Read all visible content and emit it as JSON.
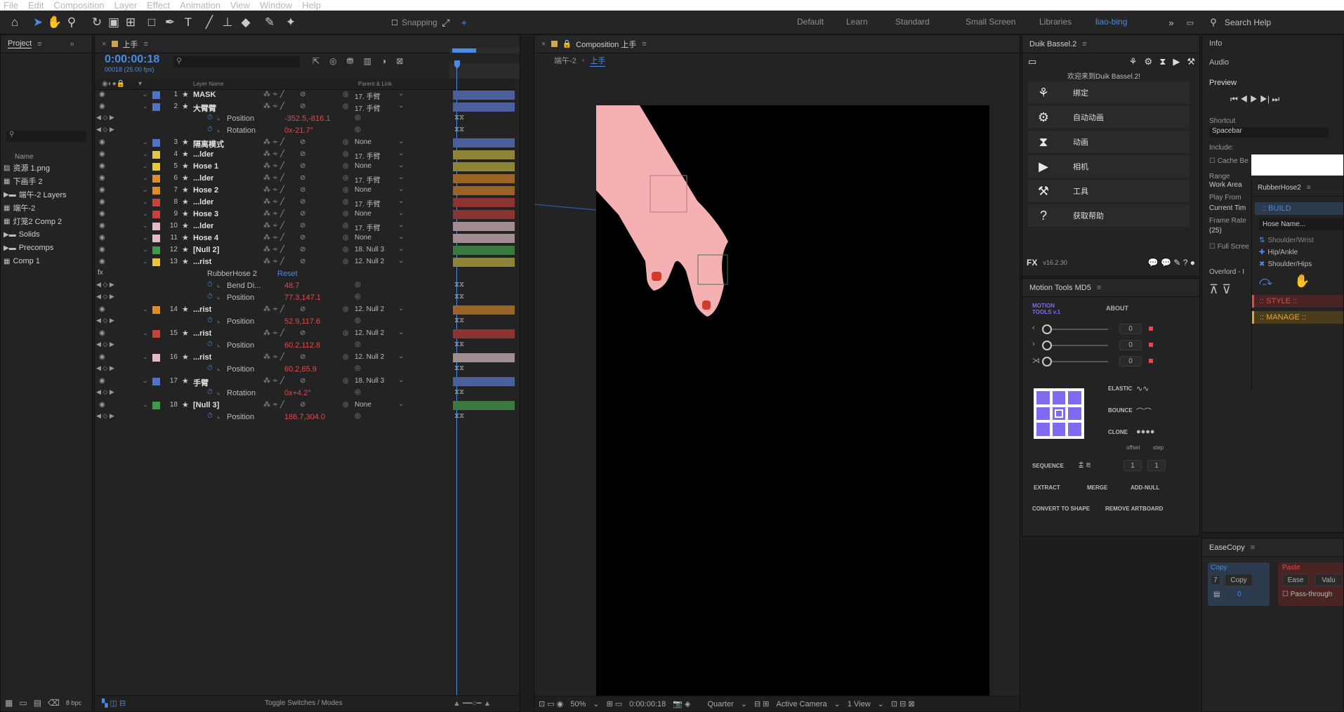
{
  "menu": [
    "File",
    "Edit",
    "Composition",
    "Layer",
    "Effect",
    "Animation",
    "View",
    "Window",
    "Help"
  ],
  "toolbar": {
    "snapping_label": "Snapping",
    "workspaces": [
      "Default",
      "Learn",
      "Standard",
      "Small Screen",
      "Libraries",
      "liao-bing"
    ],
    "active_workspace": "liao-bing",
    "search_label": "Search Help"
  },
  "project": {
    "tab": "Project",
    "search_placeholder": "",
    "name_header": "Name",
    "items": [
      {
        "label": "资源 1.png",
        "icon": "image-icon"
      },
      {
        "label": "下画手 2",
        "icon": "comp-icon"
      },
      {
        "label": "端午-2 Layers",
        "icon": "folder-icon"
      },
      {
        "label": "端午-2",
        "icon": "comp-icon"
      },
      {
        "label": "灯笼2 Comp 2",
        "icon": "comp-icon"
      },
      {
        "label": "Solids",
        "icon": "folder-icon"
      },
      {
        "label": "Precomps",
        "icon": "folder-icon"
      },
      {
        "label": "Comp 1",
        "icon": "comp-icon"
      }
    ],
    "bpc": "8 bpc"
  },
  "timeline": {
    "tab": "上手",
    "timecode": "0:00:00:18",
    "fps": "00018 (25.00 fps)",
    "col_layer_name": "Layer Name",
    "col_parent": "Parent & Link",
    "footer": "Toggle Switches / Modes",
    "rows": [
      {
        "num": "1",
        "name": "MASK",
        "parent": "17. 手臂",
        "type": "layer",
        "color": "#4e73c9",
        "bar": "#4a5f9c"
      },
      {
        "num": "2",
        "name": "大臂臂",
        "parent": "17. 手臂",
        "type": "layer",
        "color": "#4e73c9",
        "bar": "#4a5f9c"
      },
      {
        "name": "Position",
        "value": "-352.5,-816.1",
        "type": "prop"
      },
      {
        "name": "Rotation",
        "value": "0x-21.7°",
        "type": "prop"
      },
      {
        "num": "3",
        "name": "隔离模式",
        "parent": "None",
        "type": "layer",
        "color": "#4e73c9",
        "bar": "#4a5f9c"
      },
      {
        "num": "4",
        "name": "...lder",
        "parent": "17. 手臂",
        "type": "layer",
        "color": "#e8c640",
        "bar": "#8e8436"
      },
      {
        "num": "5",
        "name": "Hose 1",
        "parent": "None",
        "type": "layer",
        "color": "#e8c640",
        "bar": "#8e8436"
      },
      {
        "num": "6",
        "name": "...lder",
        "parent": "17. 手臂",
        "type": "layer",
        "color": "#e08a2a",
        "bar": "#9a6426"
      },
      {
        "num": "7",
        "name": "Hose 2",
        "parent": "None",
        "type": "layer",
        "color": "#e08a2a",
        "bar": "#9a6426"
      },
      {
        "num": "8",
        "name": "...lder",
        "parent": "17. 手臂",
        "type": "layer",
        "color": "#c9403d",
        "bar": "#8c3432"
      },
      {
        "num": "9",
        "name": "Hose 3",
        "parent": "None",
        "type": "layer",
        "color": "#c9403d",
        "bar": "#8c3432"
      },
      {
        "num": "10",
        "name": "...lder",
        "parent": "17. 手臂",
        "type": "layer",
        "color": "#e6b9c2",
        "bar": "#a28d90"
      },
      {
        "num": "11",
        "name": "Hose 4",
        "parent": "None",
        "type": "layer",
        "color": "#e6b9c2",
        "bar": "#a28d90"
      },
      {
        "num": "12",
        "name": "[Null 2]",
        "parent": "18. Null 3",
        "type": "layer",
        "color": "#3f9a48",
        "bar": "#3b7a3e"
      },
      {
        "num": "13",
        "name": "...rist",
        "parent": "12. Null 2",
        "type": "layer",
        "color": "#e8c640",
        "bar": "#8e8436"
      },
      {
        "name": "RubberHose 2",
        "value": "Reset",
        "type": "effect"
      },
      {
        "name": "Bend Di...",
        "value": "48.7",
        "type": "prop"
      },
      {
        "name": "Position",
        "value": "77.3,147.1",
        "type": "prop"
      },
      {
        "num": "14",
        "name": "...rist",
        "parent": "12. Null 2",
        "type": "layer",
        "color": "#e08a2a",
        "bar": "#9a6426"
      },
      {
        "name": "Position",
        "value": "52.9,117.6",
        "type": "prop"
      },
      {
        "num": "15",
        "name": "...rist",
        "parent": "12. Null 2",
        "type": "layer",
        "color": "#c9403d",
        "bar": "#8c3432"
      },
      {
        "name": "Position",
        "value": "60.2,112.8",
        "type": "prop"
      },
      {
        "num": "16",
        "name": "...rist",
        "parent": "12. Null 2",
        "type": "layer",
        "color": "#e6b9c2",
        "bar": "#a28d90"
      },
      {
        "name": "Position",
        "value": "60.2,65.9",
        "type": "prop"
      },
      {
        "num": "17",
        "name": "手臂",
        "parent": "18. Null 3",
        "type": "layer",
        "color": "#4e73c9",
        "bar": "#4a5f9c"
      },
      {
        "name": "Rotation",
        "value": "0x+4.2°",
        "type": "prop"
      },
      {
        "num": "18",
        "name": "[Null 3]",
        "parent": "None",
        "type": "layer",
        "color": "#3f9a48",
        "bar": "#3b7a3e"
      },
      {
        "name": "Position",
        "value": "186.7,304.0",
        "type": "prop"
      }
    ]
  },
  "composition": {
    "tab": "Composition 上手",
    "breadcrumb_parent": "端午-2",
    "breadcrumb_current": "上手",
    "zoom": "50%",
    "timecode": "0:00:00:18",
    "resolution": "Quarter",
    "camera": "Active Camera",
    "view": "1 View"
  },
  "duik": {
    "tab": "Duik Bassel.2",
    "welcome": "欢迎来到Duik Bassel.2!",
    "items": [
      "绑定",
      "自动动画",
      "动画",
      "相机",
      "工具",
      "获取帮助"
    ],
    "version": "v16.2.30"
  },
  "motion_tools": {
    "tab": "Motion Tools MD5",
    "logo_line1": "MOTION",
    "logo_line2": "TOOLS v.1",
    "about": "ABOUT",
    "slider_values": [
      "0",
      "0",
      "0"
    ],
    "elastic": "ELASTIC",
    "bounce": "BOUNCE",
    "clone": "CLONE",
    "offset": "offset",
    "step": "step",
    "sequence": "SEQUENCE",
    "seq_values": [
      "1",
      "1"
    ],
    "extract": "EXTRACT",
    "merge": "MERGE",
    "add_null": "ADD-NULL",
    "convert": "CONVERT TO SHAPE",
    "remove_artboard": "REMOVE ARTBOARD"
  },
  "right_panel": {
    "info": "Info",
    "audio": "Audio",
    "preview": "Preview",
    "shortcut_label": "Shortcut",
    "shortcut_value": "Spacebar",
    "include_label": "Include:",
    "cache_label": "Cache Be",
    "range_label": "Range",
    "range_value": "Work Area",
    "play_from_label": "Play From",
    "play_from_value": "Current Tim",
    "frame_rate_label": "Frame Rate",
    "frame_rate_value": "(25)",
    "full_screen": "Full Scree",
    "overlord": "Overlord - I"
  },
  "rubberhose": {
    "tab": "RubberHose2",
    "build": ":: BUILD",
    "hose_name_placeholder": "Hose Name...",
    "options": [
      "Shoulder/Wrist",
      "Hip/Ankle",
      "Shoulder/Hips"
    ],
    "style": ":: STYLE ::",
    "manage": ":: MANAGE ::"
  },
  "easecopy": {
    "tab": "EaseCopy",
    "copy_label": "Copy",
    "copy_button": "Copy",
    "paste_label": "Paste",
    "ease_button": "Ease",
    "value_button": "Valu",
    "copy_num": "7",
    "copy_zero": "0",
    "pass_through": "Pass-through"
  },
  "colors": {
    "accent": "#4a8be8",
    "value_red": "#e04b4b",
    "hand_pink": "#f5b1b1",
    "nail_red": "#d23a2a"
  }
}
